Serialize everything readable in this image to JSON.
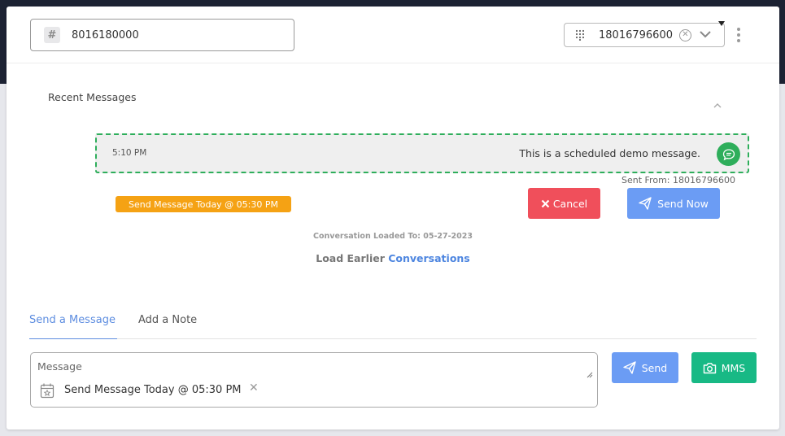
{
  "header": {
    "contact_value": "8016180000",
    "from_number": "18016796600",
    "icons": [
      "hash-icon",
      "dialpad-icon",
      "clear-icon",
      "chevron-down-icon",
      "more-vertical-icon"
    ]
  },
  "recent": {
    "title": "Recent Messages",
    "message": {
      "time": "5:10 PM",
      "text": "This is a scheduled demo message.",
      "sent_from": "Sent From: 18016796600"
    },
    "schedule_badge": "Send Message Today @ 05:30 PM",
    "cancel_label": "Cancel",
    "send_now_label": "Send Now",
    "loaded_to": "Conversation Loaded To: 05-27-2023",
    "load_earlier_prefix": "Load Earlier",
    "load_earlier_link": "Conversations"
  },
  "compose": {
    "tabs": [
      {
        "label": "Send a Message",
        "active": true
      },
      {
        "label": "Add a Note",
        "active": false
      }
    ],
    "message_placeholder": "Message",
    "scheduled_text": "Send Message Today @ 05:30 PM",
    "send_label": "Send",
    "mms_label": "MMS"
  },
  "colors": {
    "accent_blue": "#6b9cf4",
    "cancel_red": "#f04f5b",
    "green": "#2eae5b",
    "mms_green": "#18b985",
    "schedule_orange": "#f5a214"
  }
}
